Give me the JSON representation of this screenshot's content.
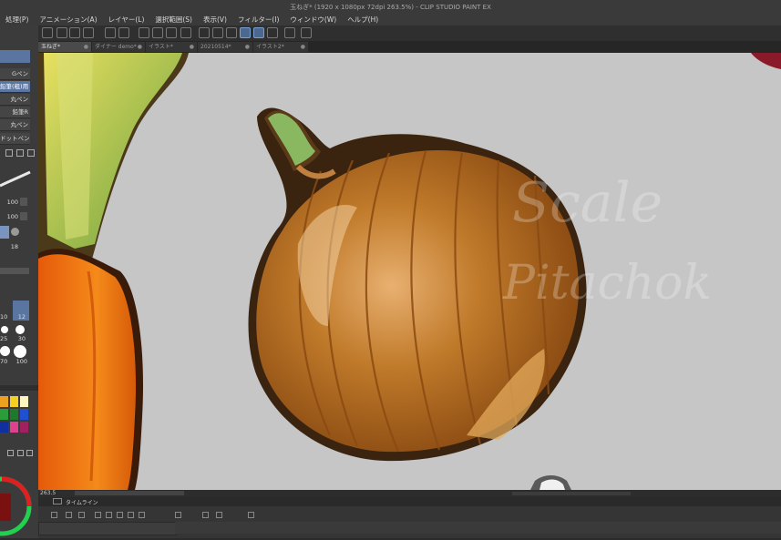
{
  "window": {
    "title": "玉ねぎ* (1920 x 1080px 72dpi 263.5%)  - CLIP STUDIO PAINT EX"
  },
  "menu": {
    "items": [
      "処理(P)",
      "アニメーション(A)",
      "レイヤー(L)",
      "選択範囲(S)",
      "表示(V)",
      "フィルター(I)",
      "ウィンドウ(W)",
      "ヘルプ(H)"
    ]
  },
  "tabs": [
    {
      "label": "玉ねぎ*",
      "active": true
    },
    {
      "label": "ダイナー demo*",
      "active": false
    },
    {
      "label": "イラスト*",
      "active": false
    },
    {
      "label": "20210514*",
      "active": false
    },
    {
      "label": "イラスト2*",
      "active": false
    }
  ],
  "subtools": [
    "Gペン",
    "鉛筆(粗)用",
    "丸ペン",
    "鉛筆R",
    "丸ペン",
    "ドットペン"
  ],
  "tool_properties": {
    "size_value": "100",
    "opacity_value": "100",
    "density_value": "18"
  },
  "brush_sizes": [
    "10",
    "12",
    "25",
    "30",
    "70",
    "100"
  ],
  "colors": {
    "accent": "#5a76a0",
    "canvas_bg": "#c6c6c6",
    "palette": [
      "#f0a020",
      "#f5d020",
      "#fff5c0",
      "#2a9d3a",
      "#1c7a2a",
      "#2050d0",
      "#1030a0",
      "#e04090",
      "#a02060"
    ]
  },
  "watermark": {
    "line1": "Scale",
    "line2": "Pitachok"
  },
  "status": {
    "zoom": "263.5"
  },
  "timeline": {
    "label": "タイムライン"
  }
}
